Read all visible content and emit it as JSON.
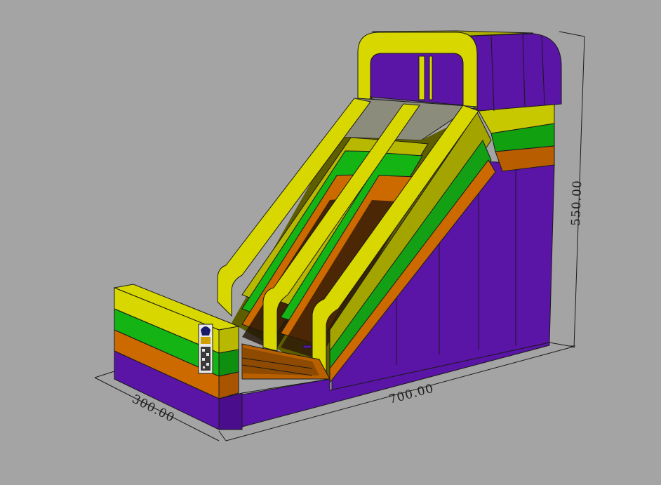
{
  "drawing": {
    "subject": "inflatable-double-lane-slide",
    "colors": {
      "background": "#a4a4a4",
      "purple": "#5a14a6",
      "purple_dark": "#4a0e8c",
      "yellow": "#d8d800",
      "yellow_dark": "#b4b400",
      "green": "#14b414",
      "green_dark": "#0f8f0f",
      "orange": "#cc6a00",
      "orange_dark": "#8a4a00",
      "mesh": "#8c8c7c",
      "line": "#1a1a1a"
    }
  },
  "dimensions": {
    "height": "550.00",
    "length": "700.00",
    "width": "300.00"
  }
}
